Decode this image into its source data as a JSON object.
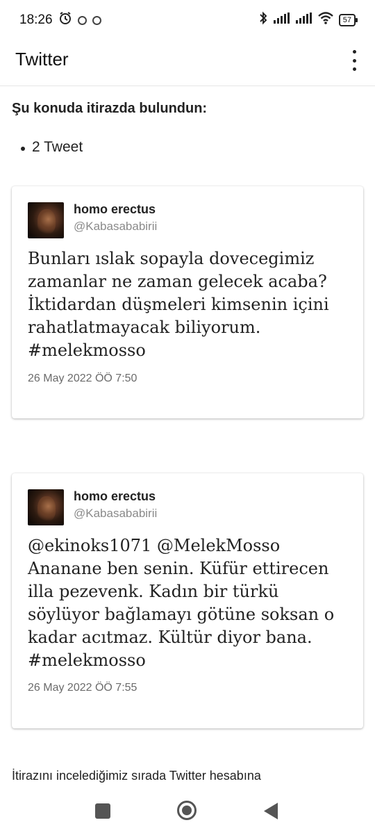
{
  "status_bar": {
    "time": "18:26",
    "battery": "57"
  },
  "app_bar": {
    "title": "Twitter"
  },
  "notice": {
    "heading": "Şu konuda itirazda bulundun:",
    "items": [
      "2 Tweet"
    ]
  },
  "tweets": [
    {
      "author_name": "homo erectus",
      "author_handle": "@Kabasababirii",
      "text": "Bunları ıslak sopayla dovecegimiz zamanlar ne zaman gelecek acaba? İktidardan düşmeleri kimsenin içini rahatlatmayacak biliyorum. #melekmosso",
      "timestamp": "26 May 2022 ÖÖ 7:50"
    },
    {
      "author_name": "homo erectus",
      "author_handle": "@Kabasababirii",
      "text": "@ekinoks1071 @MelekMosso Ananane ben senin. Küfür ettirecen illa pezevenk. Kadın bir türkü söylüyor bağlamayı götüne soksan o kadar acıtmaz. Kültür diyor bana. #melekmosso",
      "timestamp": "26 May 2022 ÖÖ 7:55"
    }
  ],
  "footer": {
    "text": "İtirazını incelediğimiz sırada Twitter hesabına"
  }
}
